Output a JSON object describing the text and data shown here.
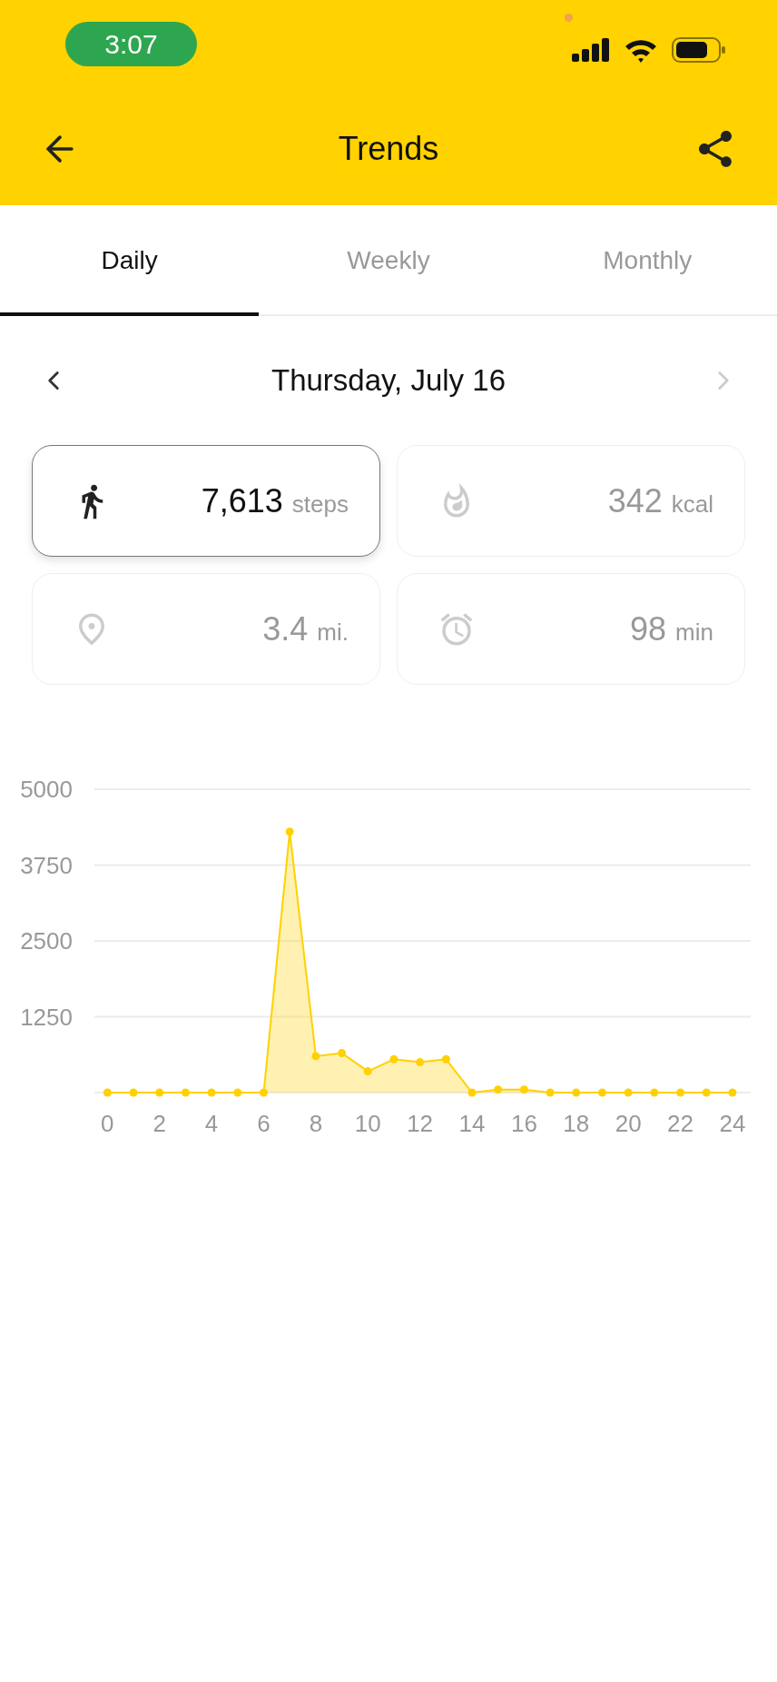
{
  "status_bar": {
    "time": "3:07"
  },
  "header": {
    "title": "Trends"
  },
  "tabs": [
    {
      "label": "Daily",
      "selected": true
    },
    {
      "label": "Weekly",
      "selected": false
    },
    {
      "label": "Monthly",
      "selected": false
    }
  ],
  "date_nav": {
    "date": "Thursday, July 16",
    "previous": {
      "disabled": false
    },
    "next": {
      "disabled": true
    }
  },
  "metrics": [
    {
      "kind": "steps",
      "value": "7,613",
      "unit": "steps",
      "selected": true
    },
    {
      "kind": "calories",
      "value": "342",
      "unit": "kcal",
      "selected": false
    },
    {
      "kind": "distance",
      "value": "3.4",
      "unit": "mi.",
      "selected": false
    },
    {
      "kind": "duration",
      "value": "98",
      "unit": "min",
      "selected": false
    }
  ],
  "chart": {
    "chart_data": {
      "type": "area",
      "x": [
        0,
        1,
        2,
        3,
        4,
        5,
        6,
        7,
        8,
        9,
        10,
        11,
        12,
        13,
        14,
        15,
        16,
        17,
        18,
        19,
        20,
        21,
        22,
        23,
        24
      ],
      "series": [
        {
          "color": "#ffd100",
          "values": [
            0,
            0,
            0,
            0,
            0,
            0,
            0,
            4300,
            600,
            650,
            350,
            550,
            500,
            550,
            0,
            50,
            50,
            0,
            0,
            0,
            0,
            0,
            0,
            0,
            0
          ]
        }
      ],
      "xlim": [
        -0.5,
        24.7
      ],
      "ylim": [
        0,
        5000
      ],
      "xticks": [
        0,
        2,
        4,
        6,
        8,
        10,
        12,
        14,
        16,
        18,
        20,
        22,
        24
      ],
      "yticks": [
        1250,
        2500,
        3750,
        5000
      ],
      "grid": true
    }
  }
}
